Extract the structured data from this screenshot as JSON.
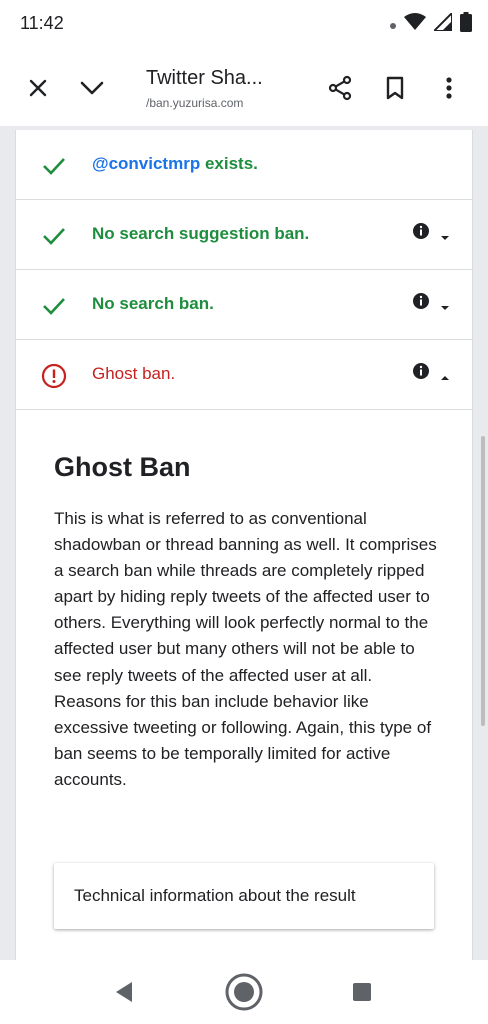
{
  "status_bar": {
    "time": "11:42",
    "icons": [
      "dot-icon",
      "wifi-icon",
      "signal-icon",
      "battery-icon"
    ]
  },
  "toolbar": {
    "title": "Twitter Sha...",
    "url": "/ban.yuzurisa.com",
    "icons": [
      "close-icon",
      "chevron-down-icon",
      "share-icon",
      "bookmark-icon",
      "more-vert-icon"
    ]
  },
  "results": [
    {
      "label": "exists.",
      "handle": "@convictmrp",
      "status": "ok"
    },
    {
      "label": "No search suggestion ban.",
      "status": "ok",
      "expanded": false
    },
    {
      "label": "No search ban.",
      "status": "ok",
      "expanded": false
    },
    {
      "label": "Ghost ban.",
      "status": "error",
      "expanded": true
    }
  ],
  "detail": {
    "title": "Ghost Ban",
    "text": "This is what is referred to as conventional shadowban or thread banning as well. It comprises a search ban while threads are completely ripped apart by hiding reply tweets of the affected user to others. Everything will look perfectly normal to the affected user but many others will not be able to see reply tweets of the affected user at all. Reasons for this ban include behavior like excessive tweeting or following. Again, this type of ban seems to be temporally limited for active accounts.",
    "button_label": "Technical information about the result"
  },
  "nav": {
    "icons": [
      "back-icon",
      "home-icon",
      "recents-icon"
    ]
  },
  "colors": {
    "ok": "#1e8e3e",
    "error": "#c5221f",
    "handle": "#1a73e8"
  }
}
